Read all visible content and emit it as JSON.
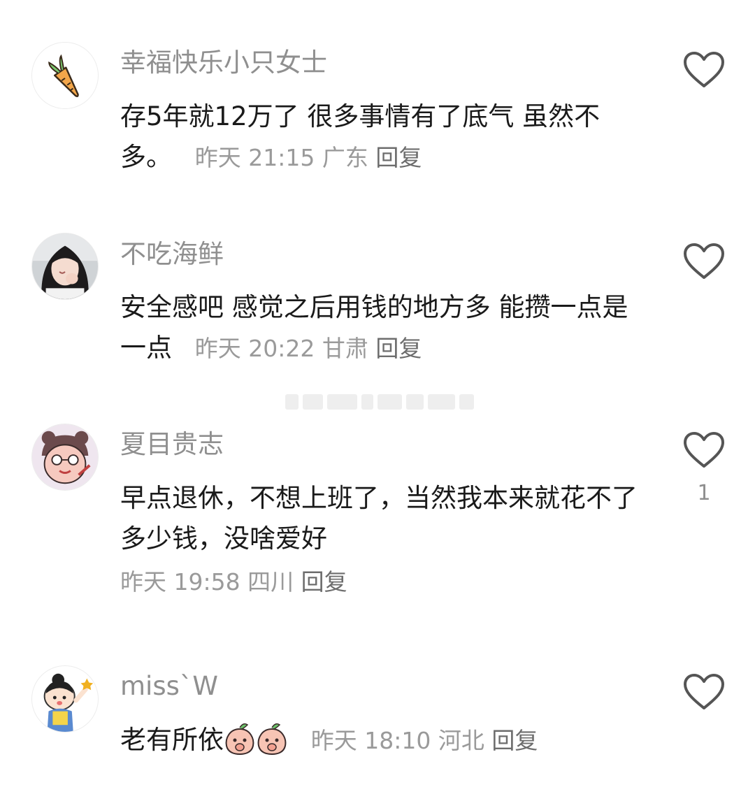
{
  "comments": [
    {
      "user": "幸福快乐小只女士",
      "avatar_icon": "carrot-icon",
      "text": "存5年就12万了  很多事情有了底气 虽然不多。",
      "time": "昨天 21:15",
      "location": "广东",
      "reply_label": "回复",
      "likes": ""
    },
    {
      "user": "不吃海鲜",
      "avatar_icon": "girl-photo-avatar",
      "text": "安全感吧 感觉之后用钱的地方多 能攒一点是一点",
      "time": "昨天 20:22",
      "location": "甘肃",
      "reply_label": "回复",
      "likes": ""
    },
    {
      "user": "夏目贵志",
      "avatar_icon": "cartoon-character-avatar",
      "text": "早点退休，不想上班了，当然我本来就花不了多少钱，没啥爱好",
      "time": "昨天 19:58",
      "location": "四川",
      "reply_label": "回复",
      "likes": "1"
    },
    {
      "user": "miss`W",
      "avatar_icon": "cartoon-kid-avatar",
      "text": "老有所依",
      "stickers": [
        "peach-sticker-icon",
        "peach-sticker-icon"
      ],
      "time": "昨天 18:10",
      "location": "河北",
      "reply_label": "回复",
      "likes": ""
    }
  ],
  "colors": {
    "username": "#8f8f8f",
    "body_text": "#1a1a1a",
    "meta": "#9a9a9a",
    "heart_stroke": "#555555"
  }
}
